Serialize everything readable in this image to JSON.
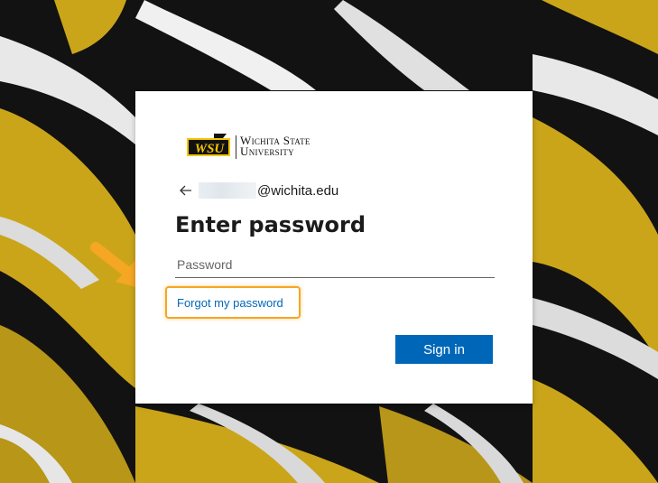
{
  "background": {
    "description_colors": {
      "gold": "#caa51a",
      "black": "#111111",
      "white": "#f2f2f2"
    }
  },
  "brand": {
    "logo_monogram": "WSU",
    "logo_line1": "Wichita State",
    "logo_line2": "University"
  },
  "identity": {
    "email_suffix": "@wichita.edu",
    "back_icon": "arrow-left-icon"
  },
  "form": {
    "title": "Enter password",
    "password_placeholder": "Password",
    "forgot_link": "Forgot my password",
    "submit_label": "Sign in"
  },
  "annotation": {
    "pointer_icon": "arrow-pointer-icon",
    "highlight_color": "#f5a623"
  },
  "colors": {
    "accent": "#0067b8"
  }
}
